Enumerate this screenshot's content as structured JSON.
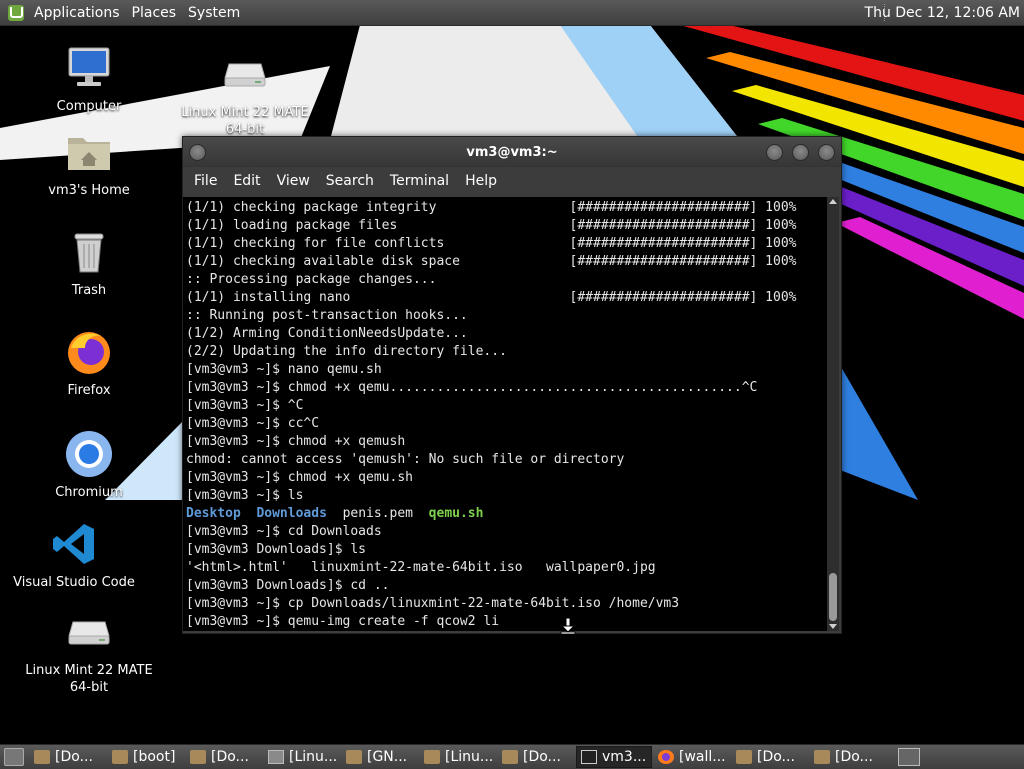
{
  "top_panel": {
    "menu": [
      "Applications",
      "Places",
      "System"
    ],
    "clock": "Thu Dec 12, 12:06 AM"
  },
  "desktop_icons": [
    {
      "label": "Computer",
      "icon": "computer-icon"
    },
    {
      "label": "Linux Mint 22 MATE 64-bit",
      "icon": "drive-icon"
    },
    {
      "label": "vm3's Home",
      "icon": "home-folder-icon"
    },
    {
      "label": "Trash",
      "icon": "trash-icon"
    },
    {
      "label": "Firefox",
      "icon": "firefox-icon"
    },
    {
      "label": "Chromium",
      "icon": "chromium-icon"
    },
    {
      "label": "Visual Studio Code",
      "icon": "vscode-icon"
    },
    {
      "label": "Linux Mint 22 MATE 64-bit",
      "icon": "drive-icon"
    }
  ],
  "terminal": {
    "title": "vm3@vm3:~",
    "menu": [
      "File",
      "Edit",
      "View",
      "Search",
      "Terminal",
      "Help"
    ],
    "lines": [
      "(1/1) checking package integrity                 [######################] 100%",
      "(1/1) loading package files                      [######################] 100%",
      "(1/1) checking for file conflicts                [######################] 100%",
      "(1/1) checking available disk space              [######################] 100%",
      ":: Processing package changes...",
      "(1/1) installing nano                            [######################] 100%",
      ":: Running post-transaction hooks...",
      "(1/2) Arming ConditionNeedsUpdate...",
      "(2/2) Updating the info directory file...",
      "[vm3@vm3 ~]$ nano qemu.sh",
      "[vm3@vm3 ~]$ chmod +x qemu.............................................^C",
      "[vm3@vm3 ~]$ ^C",
      "[vm3@vm3 ~]$ cc^C",
      "[vm3@vm3 ~]$ chmod +x qemush",
      "chmod: cannot access 'qemush': No such file or directory",
      "[vm3@vm3 ~]$ chmod +x qemu.sh",
      "[vm3@vm3 ~]$ ls"
    ],
    "ls_output": {
      "dir1": "Desktop",
      "dir2": "Downloads",
      "file": "penis.pem",
      "exec": "qemu.sh"
    },
    "lines_after": [
      "[vm3@vm3 ~]$ cd Downloads",
      "[vm3@vm3 Downloads]$ ls",
      "'<html>.html'   linuxmint-22-mate-64bit.iso   wallpaper0.jpg",
      "[vm3@vm3 Downloads]$ cd ..",
      "[vm3@vm3 ~]$ cp Downloads/linuxmint-22-mate-64bit.iso /home/vm3",
      "[vm3@vm3 ~]$ qemu-img create -f qcow2 li"
    ]
  },
  "taskbar": [
    {
      "label": "[Do...",
      "icon": "folder"
    },
    {
      "label": "[boot]",
      "icon": "folder"
    },
    {
      "label": "[Do...",
      "icon": "folder"
    },
    {
      "label": "[Linu...",
      "icon": "window"
    },
    {
      "label": "[GN...",
      "icon": "folder"
    },
    {
      "label": "[Linu...",
      "icon": "folder"
    },
    {
      "label": "[Do...",
      "icon": "folder"
    },
    {
      "label": "vm3...",
      "icon": "term",
      "active": true
    },
    {
      "label": "[wall...",
      "icon": "fox"
    },
    {
      "label": "[Do...",
      "icon": "folder"
    },
    {
      "label": "[Do...",
      "icon": "folder"
    }
  ],
  "colors": {
    "dir": "#5f9ad8",
    "exec": "#7ed24e",
    "rainbow": [
      "#e31414",
      "#ff8a00",
      "#f2e600",
      "#42d62a",
      "#2f7fe0",
      "#6a1fc9",
      "#e020d0"
    ]
  }
}
